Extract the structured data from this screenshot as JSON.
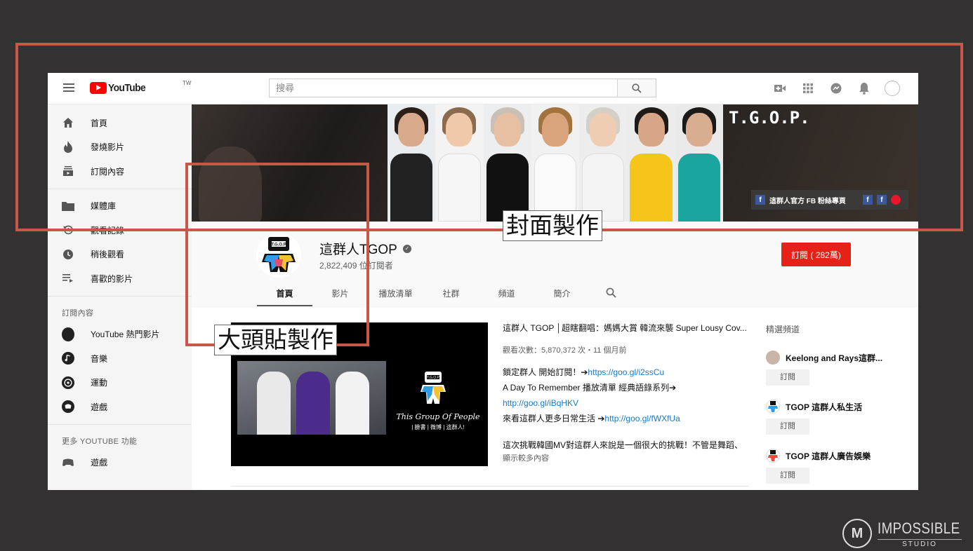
{
  "header": {
    "logo_text": "YouTube",
    "logo_region": "TW",
    "search_placeholder": "搜尋"
  },
  "sidebar": {
    "main_items": [
      {
        "label": "首頁",
        "icon": "home-icon"
      },
      {
        "label": "發燒影片",
        "icon": "trending-icon"
      },
      {
        "label": "訂閱內容",
        "icon": "subscriptions-icon"
      }
    ],
    "library_items": [
      {
        "label": "媒體庫",
        "icon": "folder-icon"
      },
      {
        "label": "觀看記錄",
        "icon": "history-icon"
      },
      {
        "label": "稍後觀看",
        "icon": "clock-icon"
      },
      {
        "label": "喜歡的影片",
        "icon": "playlist-icon"
      }
    ],
    "subscriptions_heading": "訂閱內容",
    "subscription_items": [
      {
        "label": "YouTube 熱門影片"
      },
      {
        "label": "音樂"
      },
      {
        "label": "運動"
      },
      {
        "label": "遊戲"
      }
    ],
    "more_heading": "更多 YOUTUBE 功能",
    "more_items": [
      {
        "label": "遊戲"
      }
    ]
  },
  "banner": {
    "vertical_text": "T.G.O.P.",
    "fb_text": "這群人官方 FB 粉絲專頁",
    "fb_letter": "f",
    "avatar_logo_text": "T.G.O.P"
  },
  "channel": {
    "name": "這群人TGOP",
    "subscribers": "2,822,409 位訂閱者",
    "subscribe_label": "訂閱 ( 282萬)",
    "tabs": [
      "首頁",
      "影片",
      "播放清單",
      "社群",
      "頻道",
      "簡介"
    ]
  },
  "video": {
    "title": "這群人 TGOP │超瞎翻唱：媽媽大賞 韓流來襲 Super Lousy Cov...",
    "meta": "觀看次數：5,870,372 次・11 個月前",
    "line1_text": "鎖定群人 開始訂閱！➔",
    "line1_link": "https://goo.gl/i2ssCu",
    "line2_text": "A Day To Remember 播放清單 經典語錄系列➔",
    "line3_link": "http://goo.gl/iBqHKV",
    "line4_text": "來看這群人更多日常生活 ➔",
    "line4_link": "http://goo.gl/fWXfUa",
    "line5_text": "這次挑戰韓國MV對這群人來說是一個很大的挑戰！不管是舞蹈、",
    "more": "顯示較多內容",
    "thumb_tagline": "This Group Of People",
    "thumb_sub": "| 臉書 | 微博 | 這群人!",
    "thumb_logo_text": "T.G.O.P"
  },
  "featured": {
    "heading": "精選頻道",
    "channels": [
      {
        "name": "Keelong and Rays這群...",
        "button": "訂閱"
      },
      {
        "name": "TGOP 這群人私生活",
        "button": "訂閱"
      },
      {
        "name": "TGOP 這群人廣告娛樂",
        "button": "訂閱"
      }
    ]
  },
  "annotations": {
    "cover_label": "封面製作",
    "avatar_label": "大頭貼製作"
  },
  "watermark": {
    "brand": "IMPOSSIBLE",
    "sub": "STUDIO",
    "mark": "M"
  },
  "colors": {
    "youtube_red": "#ff0000",
    "subscribe_red": "#e62117",
    "annotation_frame": "#c8574a",
    "link": "#167ac6",
    "background": "#333132"
  }
}
